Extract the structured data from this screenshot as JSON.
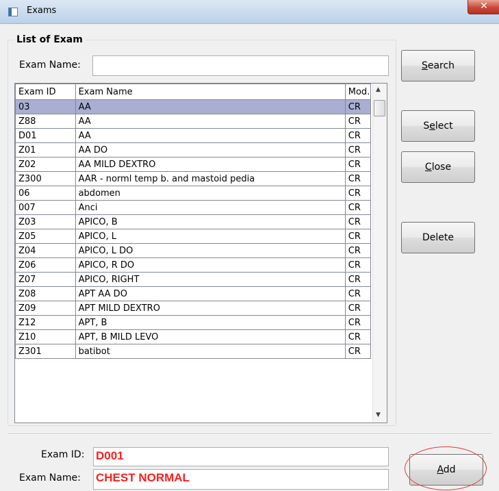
{
  "window": {
    "title": "Exams",
    "close_glyph": "✕",
    "icon": "app-window-icon"
  },
  "group": {
    "legend": "List of Exam",
    "exam_name_label": "Exam Name:",
    "exam_name_value": ""
  },
  "grid": {
    "columns": [
      "Exam ID",
      "Exam Name",
      "Mod."
    ],
    "rows": [
      {
        "id": "03",
        "name": "AA",
        "mod": "CR"
      },
      {
        "id": "Z88",
        "name": "AA",
        "mod": "CR"
      },
      {
        "id": "D01",
        "name": "AA",
        "mod": "CR"
      },
      {
        "id": "Z01",
        "name": "AA DO",
        "mod": "CR"
      },
      {
        "id": "Z02",
        "name": "AA MILD DEXTRO",
        "mod": "CR"
      },
      {
        "id": "Z300",
        "name": "AAR - norml temp b. and mastoid pedia",
        "mod": "CR"
      },
      {
        "id": "06",
        "name": "abdomen",
        "mod": "CR"
      },
      {
        "id": "007",
        "name": "Anci",
        "mod": "CR"
      },
      {
        "id": "Z03",
        "name": "APICO, B",
        "mod": "CR"
      },
      {
        "id": "Z05",
        "name": "APICO, L",
        "mod": "CR"
      },
      {
        "id": "Z04",
        "name": "APICO, L DO",
        "mod": "CR"
      },
      {
        "id": "Z06",
        "name": "APICO, R DO",
        "mod": "CR"
      },
      {
        "id": "Z07",
        "name": "APICO, RIGHT",
        "mod": "CR"
      },
      {
        "id": "Z08",
        "name": "APT AA DO",
        "mod": "CR"
      },
      {
        "id": "Z09",
        "name": "APT MILD DEXTRO",
        "mod": "CR"
      },
      {
        "id": "Z12",
        "name": "APT, B",
        "mod": "CR"
      },
      {
        "id": "Z10",
        "name": "APT, B MILD LEVO",
        "mod": "CR"
      },
      {
        "id": "Z301",
        "name": "batibot",
        "mod": "CR"
      }
    ],
    "selected_index": 0,
    "scroll_up_glyph": "▲",
    "scroll_down_glyph": "▼"
  },
  "buttons": {
    "search": {
      "pre": "",
      "key": "S",
      "post": "earch"
    },
    "select": {
      "pre": "S",
      "key": "e",
      "post": "lect"
    },
    "close": {
      "pre": "",
      "key": "C",
      "post": "lose"
    },
    "delete": {
      "label": "Delete"
    },
    "add": {
      "pre": "",
      "key": "A",
      "post": "dd"
    }
  },
  "bottom": {
    "exam_id_label": "Exam ID:",
    "exam_id_value": "D001",
    "exam_name_label": "Exam Name:",
    "exam_name_value": "CHEST NORMAL"
  },
  "colors": {
    "selected_row": "#aaaed2",
    "entry_text": "#ff1e1e",
    "annotation_circle": "#e23b3b"
  }
}
